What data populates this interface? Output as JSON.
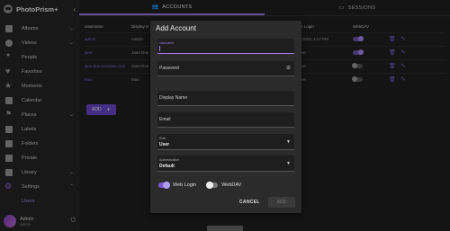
{
  "app": {
    "name": "PhotoPrism+"
  },
  "sidebar": {
    "items": [
      {
        "label": "Albums",
        "icon": "album-icon",
        "chevron": "⌄"
      },
      {
        "label": "Videos",
        "icon": "play-icon",
        "chevron": "⌄"
      },
      {
        "label": "People",
        "icon": "person-icon"
      },
      {
        "label": "Favorites",
        "icon": "heart-icon"
      },
      {
        "label": "Moments",
        "icon": "star-icon"
      },
      {
        "label": "Calendar",
        "icon": "calendar-icon"
      },
      {
        "label": "Places",
        "icon": "pin-icon",
        "chevron": "⌄"
      },
      {
        "label": "Labels",
        "icon": "label-icon"
      },
      {
        "label": "Folders",
        "icon": "folder-icon"
      },
      {
        "label": "Private",
        "icon": "lock-icon"
      },
      {
        "label": "Library",
        "icon": "library-icon",
        "chevron": "⌄"
      },
      {
        "label": "Settings",
        "icon": "gear-icon",
        "chevron": "⌃"
      },
      {
        "label": "Users",
        "icon": "",
        "sub": true
      }
    ],
    "user": {
      "name": "Admin",
      "email": "admin"
    }
  },
  "tabs": [
    {
      "label": "ACCOUNTS",
      "icon": "users-icon"
    },
    {
      "label": "SESSIONS",
      "icon": "monitor-icon"
    }
  ],
  "table": {
    "headers": [
      "Username",
      "Display N",
      "",
      "",
      "Last Login",
      "WebDAV",
      ""
    ],
    "rows": [
      {
        "username": "admin",
        "display": "Admin",
        "last_login": "5/3/2023, 4:17 PM",
        "webdav": true
      },
      {
        "username": "jane",
        "display": "Jane Doe",
        "last_login": "Never",
        "webdav": true
      },
      {
        "username": "jane.doe.example.com",
        "display": "Jane Doe",
        "last_login": "Never",
        "webdav": false
      },
      {
        "username": "max",
        "display": "Max",
        "last_login": "Never",
        "webdav": false
      }
    ]
  },
  "add_button": "ADD",
  "dialog": {
    "title": "Add Account",
    "username_label": "Username",
    "password_placeholder": "Password",
    "password_counter": "0 / 72",
    "display_name_placeholder": "Display Name",
    "email_placeholder": "Email",
    "role_label": "Role",
    "role_value": "User",
    "auth_label": "Authentication",
    "auth_value": "Default",
    "web_login_label": "Web Login",
    "webdav_label": "WebDAV",
    "cancel_label": "CANCEL",
    "add_label": "ADD"
  },
  "colors": {
    "accent": "#9c7ee8",
    "button": "#6a48c9"
  }
}
